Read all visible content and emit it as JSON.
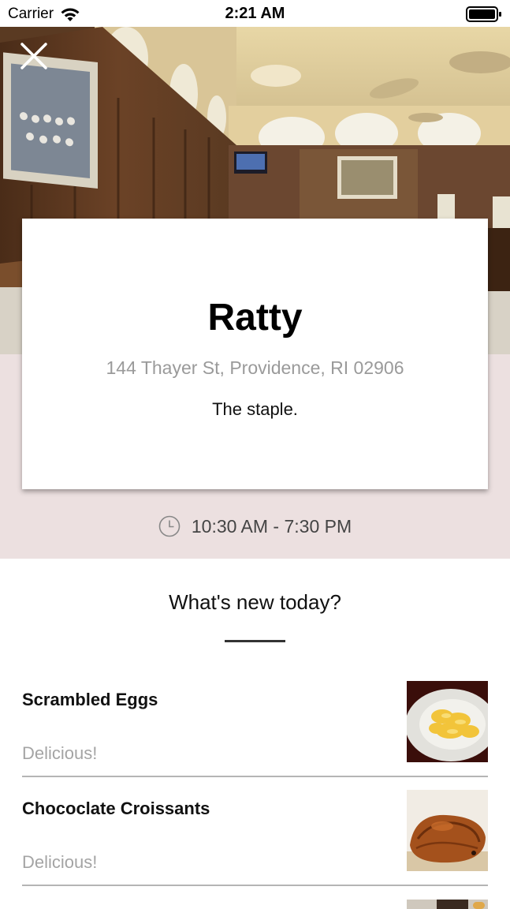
{
  "status_bar": {
    "carrier": "Carrier",
    "time": "2:21 AM"
  },
  "hero": {
    "close_icon": "close-icon",
    "photo": "dining-hall-photo"
  },
  "card": {
    "title": "Ratty",
    "address": "144 Thayer St, Providence, RI 02906",
    "tagline": "The staple."
  },
  "hours": {
    "icon": "clock-icon",
    "text": "10:30 AM - 7:30 PM"
  },
  "section": {
    "title": "What's new today?"
  },
  "menu_items": [
    {
      "name": "Scrambled Eggs",
      "description": "Delicious!",
      "thumbnail": "scrambled-eggs-photo"
    },
    {
      "name": "Chococlate Croissants",
      "description": "Delicious!",
      "thumbnail": "chocolate-croissant-photo"
    }
  ],
  "colors": {
    "band": "#ece0e0",
    "address": "#9a9a9a",
    "description": "#a4a4a4",
    "divider": "#b5b5b5"
  }
}
